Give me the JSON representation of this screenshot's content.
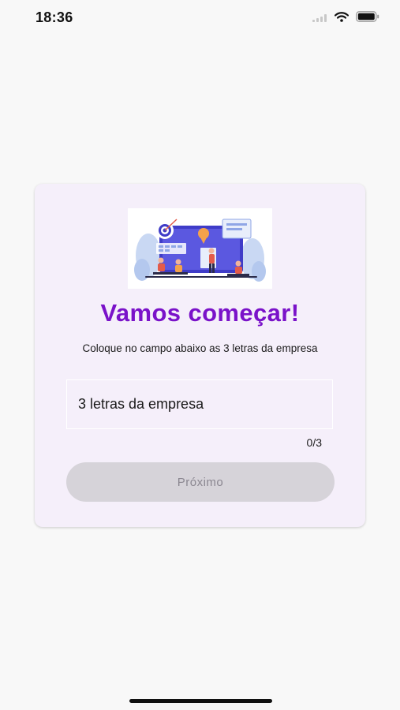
{
  "status_bar": {
    "time": "18:36",
    "icons": [
      "cellular-signal-icon",
      "wifi-icon",
      "battery-icon"
    ]
  },
  "card": {
    "illustration": "team-presentation-illustration",
    "title": "Vamos começar!",
    "subtitle": "Coloque no campo abaixo as 3 letras da empresa",
    "input": {
      "placeholder": "3 letras da empresa",
      "value": ""
    },
    "counter": "0/3",
    "next_button_label": "Próximo"
  },
  "colors": {
    "title": "#7a12c9",
    "card_background": "#f5effa",
    "button_disabled_background": "#d6d3d9",
    "button_disabled_text": "#8a8690"
  }
}
